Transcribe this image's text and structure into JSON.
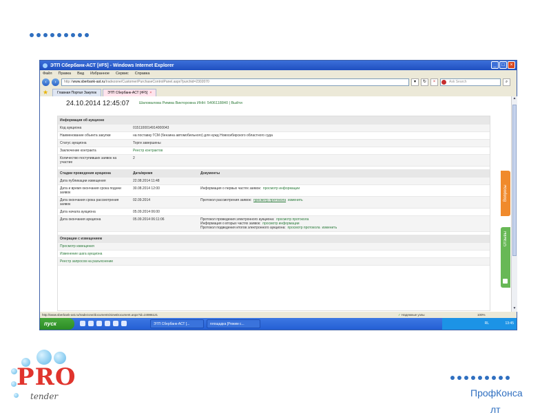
{
  "window": {
    "title": "ЭТП Сбербанк-АСТ [#F5] - Windows Internet Explorer",
    "menu": [
      "Файл",
      "Правка",
      "Вид",
      "Избранное",
      "Сервис",
      "Справка"
    ],
    "url_domain": "www.sberbank-ast.ru",
    "url_rest": "/tradezone/Customer/PurchaseControlPanel.aspx?purchid=2302070",
    "url_prefix": "http://",
    "search_placeholder": "Ask Search",
    "tabs": [
      {
        "label": "Главная Портал Закупок"
      },
      {
        "label": "ЭТП Сбербанк-АСТ [#F5]"
      }
    ]
  },
  "page": {
    "datetime": "24.10.2014 12:45:07",
    "user_line": "Шаповалова Римма Викторовна ИНН: 5406118840 | Выйти"
  },
  "auction_info": {
    "header": "Информация об аукционе",
    "rows": [
      {
        "label": "Код аукциона",
        "value": "0151100014914000043"
      },
      {
        "label": "Наименование объекта закупки",
        "value": "на поставку ГСМ (бензина автомобильного) для нужд Новосибирского областного суда"
      },
      {
        "label": "Статус аукциона",
        "value": "Торги завершены"
      },
      {
        "label": "Заключение контракта",
        "value": "Реестр контрактов"
      },
      {
        "label": "Количество поступивших заявок на участие",
        "value": "2"
      }
    ]
  },
  "stages": {
    "headers": [
      "Стадии проведения аукциона",
      "Дата/время",
      "Документы"
    ],
    "rows": [
      {
        "stage": "Дата публикации извещения",
        "date": "22.08.2014 11:48",
        "docs": ""
      },
      {
        "stage": "Дата и время окончания срока подачи заявок",
        "date": "30.08.2014 12:00",
        "docs": "Информация о первых частях заявок:",
        "link1": "просмотр информации"
      },
      {
        "stage": "Дата окончания срока рассмотрения заявок",
        "date": "02.09.2014",
        "docs": "Протокол рассмотрения заявок:",
        "link1": "просмотр протокола",
        "link2": "изменить"
      },
      {
        "stage": "Дата начала аукциона",
        "date": "05.09.2014 06:00",
        "docs": ""
      },
      {
        "stage": "Дата окончания аукциона",
        "date": "05.09.2014 06:11:06",
        "docs_lines": [
          {
            "text": "Протокол проведения электронного аукциона:",
            "link1": "просмотр протокола"
          },
          {
            "text": "Информация о вторых частях заявок:",
            "link1": "просмотр информации"
          },
          {
            "text": "Протокол подведения итогов электронного аукциона:",
            "link1": "просмотр протокола",
            "link2": "изменить"
          }
        ]
      }
    ]
  },
  "operations": {
    "header": "Операции с извещением",
    "links": [
      "Просмотр извещения",
      "Изменение шага аукциона",
      "Реестр запросов на разъяснение"
    ]
  },
  "side_tabs": {
    "questions": "Вопросы",
    "reviews": "Отзывы"
  },
  "status_bar": {
    "url": "http://www.sberbank-ast.ru/tradezone/documents/viewDocument.aspx?id=24986121",
    "zone": "Надежные узлы",
    "zoom": "100%"
  },
  "taskbar": {
    "start": "пуск",
    "tasks": [
      "ЭТП Сбербанк-АСТ [...",
      "площадка [Режим с..."
    ],
    "tray_lang": "RL",
    "clock": "13:45"
  },
  "logo": {
    "main": "PRO",
    "sub": "tender"
  },
  "brand_line1": "ПрофКонса",
  "brand_line2": "лт",
  "colors": {
    "accent": "#2f6fc0",
    "logo_red": "#e0342d",
    "link_green": "#2a7a3a",
    "orange_tab": "#f08a2c",
    "green_tab": "#68b856"
  }
}
